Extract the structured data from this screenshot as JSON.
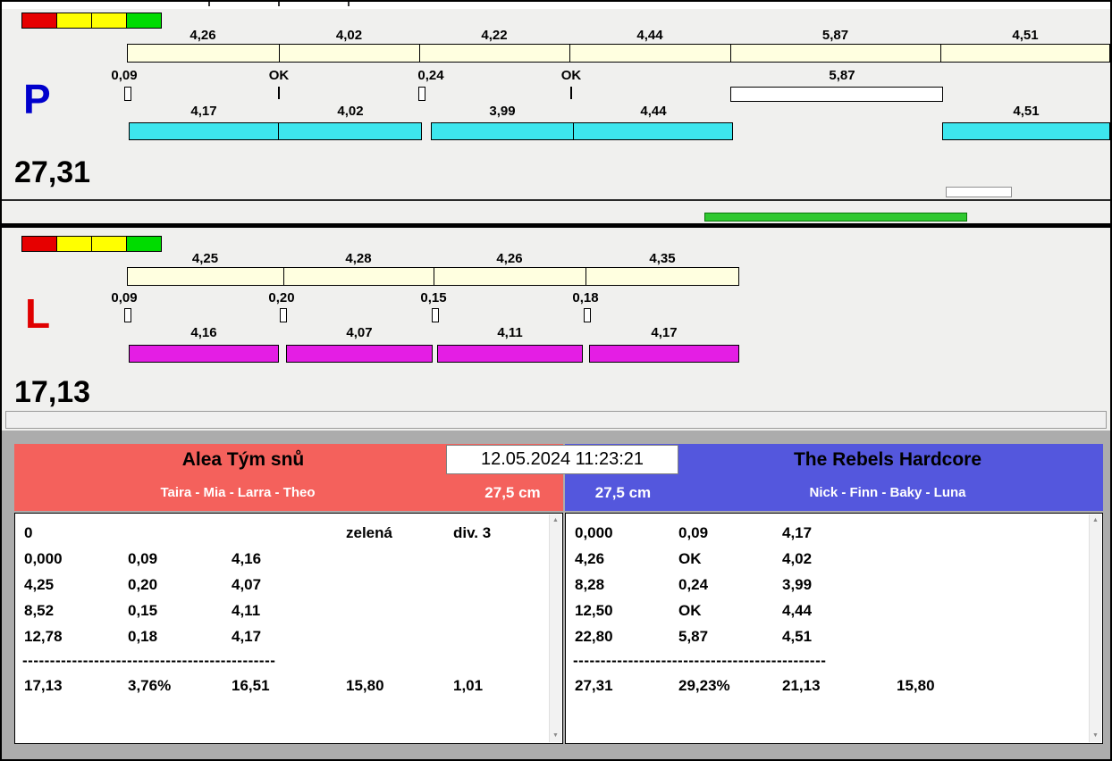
{
  "header": {
    "timestamp": "12.05.2024 11:23:21"
  },
  "panel_p": {
    "label": "P",
    "total": "27,31",
    "ref_values": [
      "4,26",
      "4,02",
      "4,22",
      "4,44",
      "5,87",
      "4,51"
    ],
    "split_values": [
      "0,09",
      "OK",
      "0,24",
      "OK",
      "5,87"
    ],
    "run_values": [
      "4,17",
      "4,02",
      "3,99",
      "4,44",
      "4,51"
    ]
  },
  "panel_l": {
    "label": "L",
    "total": "17,13",
    "ref_values": [
      "4,25",
      "4,28",
      "4,26",
      "4,35"
    ],
    "split_values": [
      "0,09",
      "0,20",
      "0,15",
      "0,18"
    ],
    "run_values": [
      "4,16",
      "4,07",
      "4,11",
      "4,17"
    ]
  },
  "team_left": {
    "name": "Alea Tým snů",
    "members": "Taira - Mia - Larra - Theo",
    "height_label": "27,5 cm",
    "info_row": [
      "0",
      "zelená",
      "div. 3"
    ],
    "rows": [
      [
        "0,000",
        "0,09",
        "4,16"
      ],
      [
        "4,25",
        "0,20",
        "4,07"
      ],
      [
        "8,52",
        "0,15",
        "4,11"
      ],
      [
        "12,78",
        "0,18",
        "4,17"
      ]
    ],
    "divider": "----------------------------------------------",
    "totals": [
      "17,13",
      "3,76%",
      "16,51",
      "15,80",
      "1,01"
    ]
  },
  "team_right": {
    "name": "The Rebels Hardcore",
    "members": "Nick - Finn - Baky - Luna",
    "height_label": "27,5 cm",
    "rows": [
      [
        "0,000",
        "0,09",
        "4,17"
      ],
      [
        "4,26",
        "OK",
        "4,02"
      ],
      [
        "8,28",
        "0,24",
        "3,99"
      ],
      [
        "12,50",
        "OK",
        "4,44"
      ],
      [
        "22,80",
        "5,87",
        "4,51"
      ]
    ],
    "divider": "----------------------------------------------",
    "totals": [
      "27,31",
      "29,23%",
      "21,13",
      "15,80"
    ]
  },
  "scroll": {
    "up": "▲",
    "down": "▼"
  }
}
